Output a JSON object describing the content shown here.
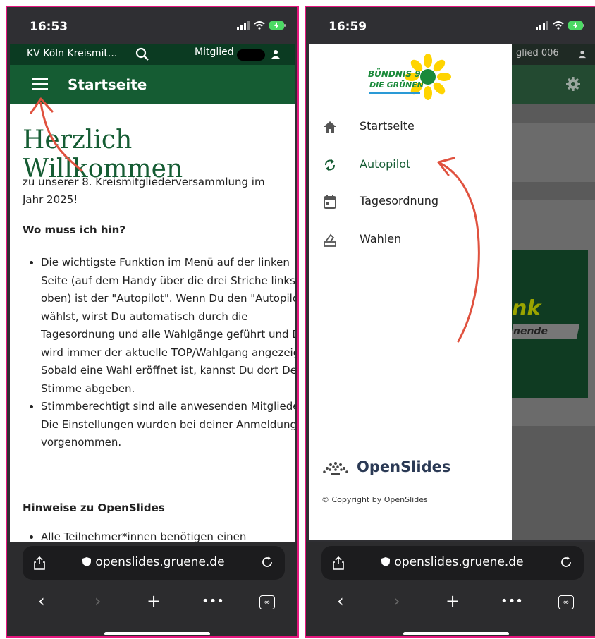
{
  "left_phone": {
    "status_time": "16:53",
    "topbar_meeting": "KV Köln Kreismit...",
    "topbar_user": "Mitglied",
    "appbar_title": "Startseite",
    "content": {
      "heading": "Herzlich Willkommen",
      "intro": "zu unserer 8. Kreismitgliederversammlung im Jahr 2025!",
      "section1_title": "Wo muss ich hin?",
      "bullets": [
        "Die wichtigste Funktion im Menü auf der linken Seite (auf dem Handy über die drei Striche links oben) ist der \"Autopilot\". Wenn Du den \"Autopilot\" wählst, wirst Du automatisch durch die Tagesordnung und alle Wahlgänge geführt und Dir wird immer der aktuelle TOP/Wahlgang angezeigt. Sobald eine Wahl eröffnet ist, kannst Du dort Deine Stimme abgeben.",
        "Stimmberechtigt sind alle anwesenden Mitglieder. Die Einstellungen wurden bei deiner Anmeldung vorgenommen."
      ],
      "section2_title": "Hinweise zu OpenSlides",
      "bullet_cut": "Alle Teilnehmer*innen benötigen einen"
    },
    "browser": {
      "url": "openslides.gruene.de"
    }
  },
  "right_phone": {
    "status_time": "16:59",
    "topbar_user_partial": "glied 006",
    "logo_line1": "BÜNDNIS 90",
    "logo_line2": "DIE GRÜNEN",
    "menu": [
      {
        "label": "Startseite",
        "icon": "home-icon",
        "active": false
      },
      {
        "label": "Autopilot",
        "icon": "sync-icon",
        "active": true
      },
      {
        "label": "Tagesordnung",
        "icon": "calendar-icon",
        "active": false
      },
      {
        "label": "Wahlen",
        "icon": "vote-icon",
        "active": false
      }
    ],
    "footer_brand": "OpenSlides",
    "footer_copyright": "© Copyright by OpenSlides",
    "bg_banner_partial_1": "nk",
    "bg_banner_partial_2": "nende",
    "browser": {
      "url": "openslides.gruene.de"
    }
  },
  "colors": {
    "frame": "#e5177e",
    "appbar_green": "#155c33",
    "topbar_dark_green": "#0b3b22",
    "arrow_red": "#e0523f",
    "logo_yellow": "#ffd400"
  }
}
